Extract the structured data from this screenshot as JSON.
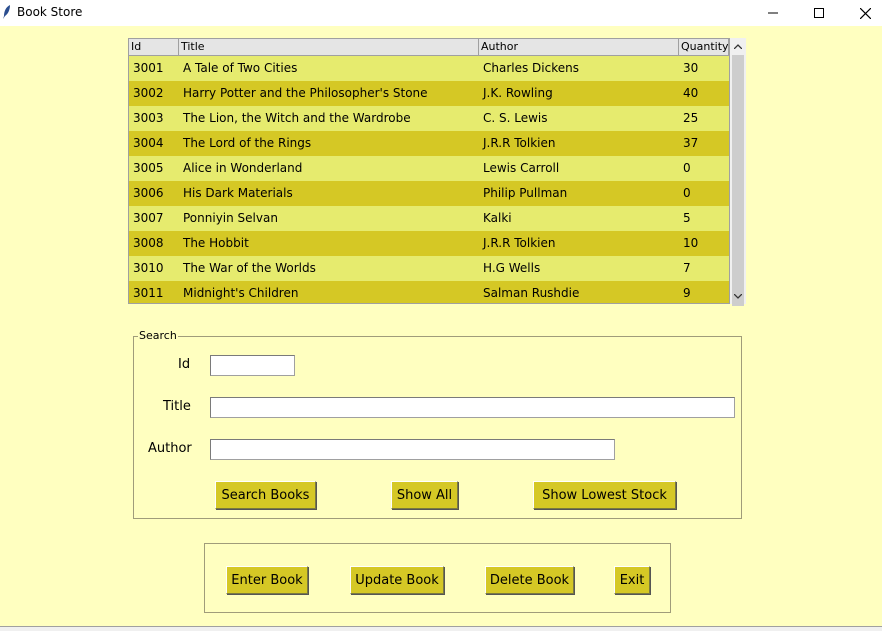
{
  "window": {
    "title": "Book Store"
  },
  "table": {
    "headers": [
      "Id",
      "Title",
      "Author",
      "Quantity"
    ],
    "rows": [
      [
        "3001",
        "A Tale of Two Cities",
        "Charles Dickens",
        "30"
      ],
      [
        "3002",
        "Harry Potter and the Philosopher's Stone",
        "J.K. Rowling",
        "40"
      ],
      [
        "3003",
        "The Lion, the Witch and the Wardrobe",
        "C. S. Lewis",
        "25"
      ],
      [
        "3004",
        "The Lord of the Rings",
        "J.R.R Tolkien",
        "37"
      ],
      [
        "3005",
        "Alice in Wonderland",
        "Lewis Carroll",
        "0"
      ],
      [
        "3006",
        "His Dark Materials",
        "Philip Pullman",
        "0"
      ],
      [
        "3007",
        "Ponniyin Selvan",
        "Kalki",
        "5"
      ],
      [
        "3008",
        "The Hobbit",
        "J.R.R Tolkien",
        "10"
      ],
      [
        "3010",
        "The War of the Worlds",
        "H.G Wells",
        "7"
      ],
      [
        "3011",
        "Midnight's Children",
        "Salman Rushdie",
        "9"
      ]
    ]
  },
  "search": {
    "legend": "Search",
    "id_label": "Id",
    "title_label": "Title",
    "author_label": "Author",
    "id_value": "",
    "title_value": "",
    "author_value": "",
    "search_button": "Search Books",
    "show_all_button": "Show All",
    "lowest_stock_button": "Show Lowest Stock"
  },
  "actions": {
    "enter_button": "Enter Book",
    "update_button": "Update Book",
    "delete_button": "Delete Book",
    "exit_button": "Exit"
  },
  "colors": {
    "background": "#ffffc0",
    "row_light": "#e6eb6e",
    "row_dark": "#d5c825",
    "button": "#d5c825"
  }
}
